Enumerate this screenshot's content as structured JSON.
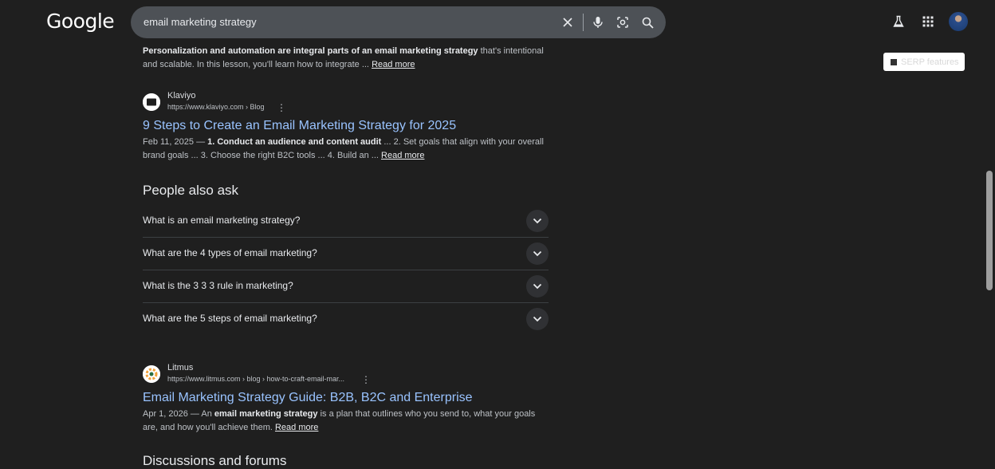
{
  "header": {
    "logo_text": "Google",
    "search_query": "email marketing strategy",
    "icons": [
      "close-icon",
      "microphone-icon",
      "lens-icon",
      "search-icon",
      "labs-flask-icon",
      "apps-grid-icon",
      "avatar"
    ]
  },
  "serp_badge": {
    "label": "SERP features"
  },
  "top_snippet": {
    "bold_lead": "Personalization and automation are integral parts of an email marketing strategy",
    "text": " that's intentional and scalable. In this lesson, you'll learn how to integrate ...",
    "read_more": "Read more"
  },
  "results": [
    {
      "site_name": "Klaviyo",
      "url": "https://www.klaviyo.com › Blog",
      "title": "9 Steps to Create an Email Marketing Strategy for 2025",
      "date": "Feb 11, 2025 — ",
      "bold_1": "1. Conduct an audience and content audit",
      "text_1": " ... 2. Set goals that align with your overall brand goals ... 3. Choose the right B2C tools ... 4. Build an ...",
      "read_more": "Read more"
    },
    {
      "site_name": "Litmus",
      "url": "https://www.litmus.com › blog › how-to-craft-email-mar...",
      "title": "Email Marketing Strategy Guide: B2B, B2C and Enterprise",
      "date": "Apr 1, 2026 — ",
      "text_0": "An ",
      "bold_1": "email marketing strategy",
      "text_1": " is a plan that outlines who you send to, what your goals are, and how you'll achieve them.",
      "read_more": "Read more"
    }
  ],
  "people_also_ask": {
    "heading": "People also ask",
    "questions": [
      "What is an email marketing strategy?",
      "What are the 4 types of email marketing?",
      "What is the 3 3 3 rule in marketing?",
      "What are the 5 steps of email marketing?"
    ]
  },
  "discussions": {
    "heading": "Discussions and forums"
  },
  "colors": {
    "background": "#1f1f1f",
    "link": "#99c3ff",
    "searchbar": "#4d5156"
  }
}
